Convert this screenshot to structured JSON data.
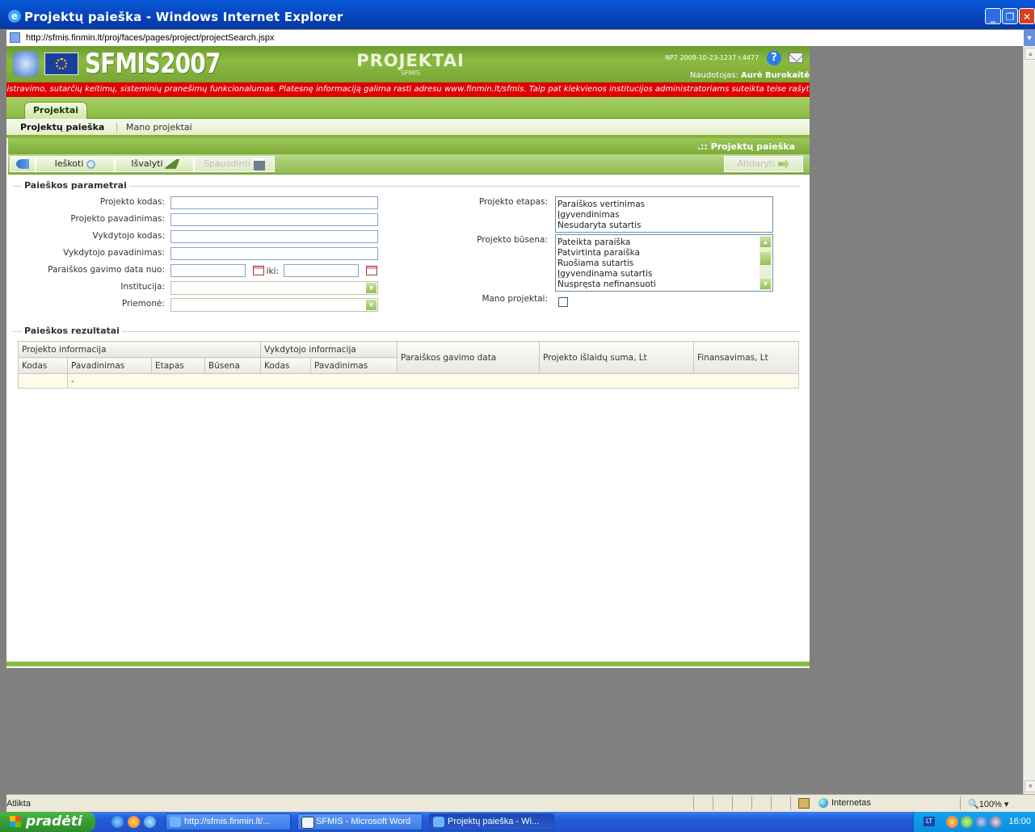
{
  "window": {
    "title": "Projektų paieška - Windows Internet Explorer",
    "url": "http://sfmis.finmin.lt/proj/faces/pages/project/projectSearch.jspx"
  },
  "app": {
    "logo": "SFMIS2007",
    "module": "PROJEKTAI",
    "module_sub": "SFMIS",
    "version": "NP7 2008-10-23-1237 r.4477",
    "user_label": "Naudotojas:",
    "user_name": "Aurė Burokaitė",
    "marquee": "egistravimo, sutarčių keitimų, sisteminių pranešimų funkcionalumas. Platesnę informaciją galima rasti adresu www.finmin.lt/sfmis. Taip pat kiekvienos institucijos administratoriams suteikta teise rašyti informaci",
    "tab": "Projektai",
    "subnav": [
      "Projektų paieška",
      "Mano projektai"
    ],
    "page_title": ".:: Projektų paieška"
  },
  "toolbar": {
    "search": "Ieškoti",
    "clear": "Išvalyti",
    "print": "Spausdinti",
    "close": "Atidaryti"
  },
  "params": {
    "legend": "Paieškos parametrai",
    "project_code": "Projekto kodas:",
    "project_name": "Projekto pavadinimas:",
    "executor_code": "Vykdytojo kodas:",
    "executor_name": "Vykdytojo pavadinimas:",
    "date_from": "Paraiškos gavimo data nuo:",
    "date_to": "iki:",
    "institution": "Institucija:",
    "measure": "Priemonė:",
    "stage_label": "Projekto etapas:",
    "stages": [
      "Paraiškos vertinimas",
      "Įgyvendinimas",
      "Nesudaryta sutartis"
    ],
    "status_label": "Projekto būsena:",
    "statuses": [
      "Pateikta paraiška",
      "Patvirtinta paraiška",
      "Ruošiama sutartis",
      "Įgyvendinama sutartis",
      "Nuspręsta nefinansuoti"
    ],
    "my_projects": "Mano projektai:"
  },
  "results": {
    "legend": "Paieškos rezultatai",
    "group_project": "Projekto informacija",
    "group_executor": "Vykdytojo informacija",
    "col_app_date": "Paraiškos gavimo data",
    "col_expenses": "Projekto išlaidų suma, Lt",
    "col_financing": "Finansavimas, Lt",
    "cols": [
      "Kodas",
      "Pavadinimas",
      "Etapas",
      "Būsena",
      "Kodas",
      "Pavadinimas"
    ],
    "empty_cell": "-"
  },
  "status": {
    "text": "Atlikta",
    "zone": "Internetas",
    "zoom": "100%"
  },
  "taskbar": {
    "start": "pradėti",
    "tasks": [
      "http://sfmis.finmin.lt/...",
      "SFMIS - Microsoft Word",
      "Projektų paieška - Wi..."
    ],
    "lang": "LT",
    "clock": "16:00"
  }
}
